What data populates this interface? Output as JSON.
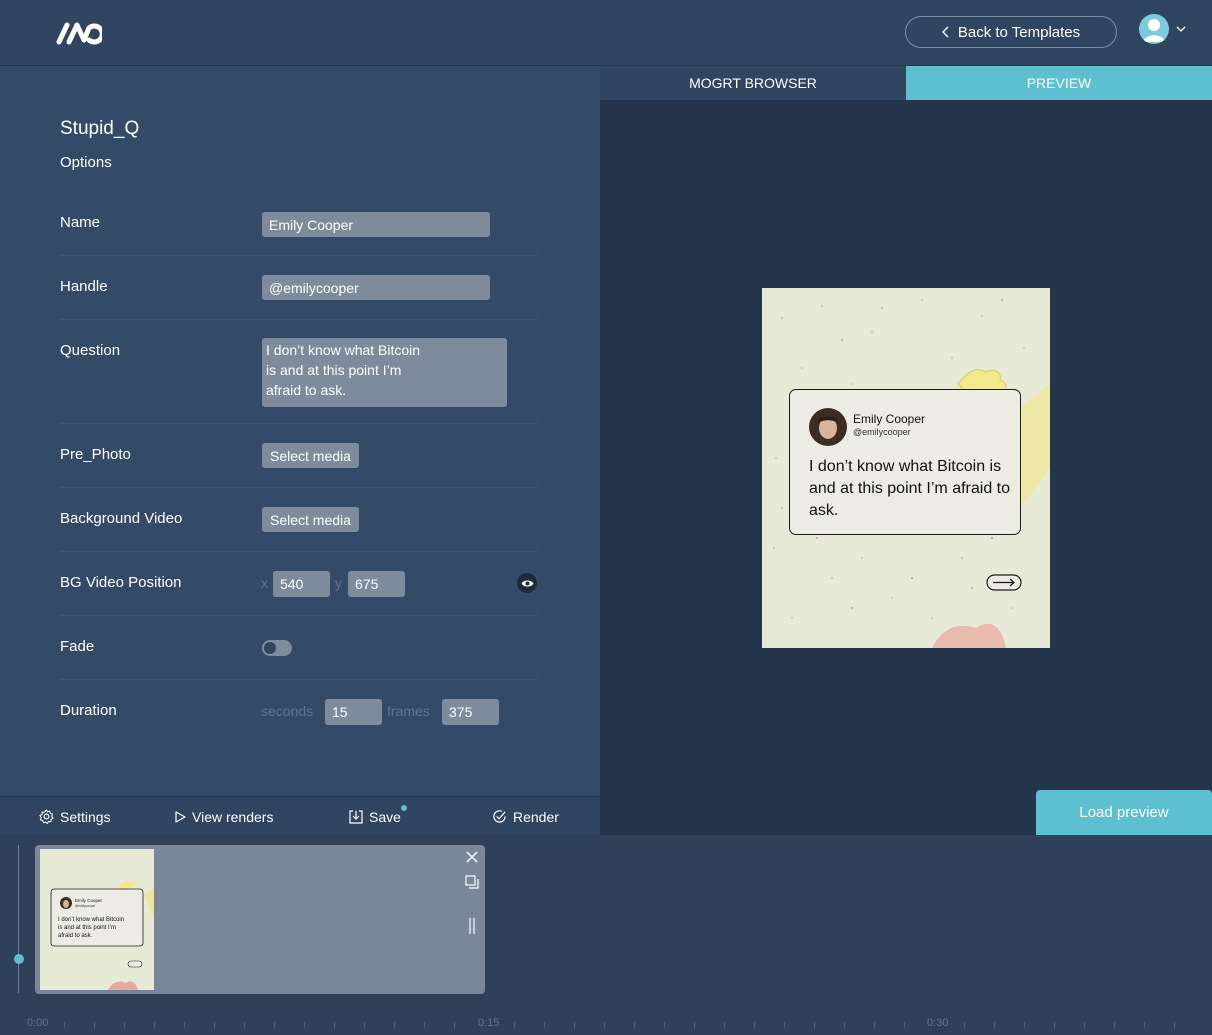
{
  "header": {
    "back_label": "Back to Templates"
  },
  "tabs": [
    {
      "label": "MOGRT BROWSER",
      "active": false
    },
    {
      "label": "PREVIEW",
      "active": true
    }
  ],
  "form": {
    "title": "Stupid_Q",
    "subtitle": "Options",
    "name": {
      "label": "Name",
      "value": "Emily Cooper"
    },
    "handle": {
      "label": "Handle",
      "value": "@emilycooper"
    },
    "question": {
      "label": "Question",
      "value": "I don’t know what Bitcoin\nis and at this point I’m\nafraid to ask."
    },
    "pre_photo": {
      "label": "Pre_Photo",
      "button": "Select media"
    },
    "bg_video": {
      "label": "Background Video",
      "button": "Select media"
    },
    "bg_position": {
      "label": "BG Video Position",
      "x_label": "x",
      "x": "540",
      "y_label": "y",
      "y": "675"
    },
    "fade": {
      "label": "Fade",
      "on": false
    },
    "duration": {
      "label": "Duration",
      "seconds_label": "seconds",
      "seconds": "15",
      "frames_label": "frames",
      "frames": "375"
    }
  },
  "toolbar": {
    "settings": "Settings",
    "view_renders": "View renders",
    "save": "Save",
    "render": "Render"
  },
  "preview": {
    "load_label": "Load preview",
    "tweet_name": "Emily Cooper",
    "tweet_handle": "@emilycooper",
    "tweet_text": "I don’t know what Bitcoin is and at this point I’m afraid to ask."
  },
  "timeline": {
    "labels": [
      "0:00",
      "0:15",
      "0:30"
    ]
  },
  "colors": {
    "accent": "#5dbfcf",
    "panel": "#334b66",
    "preview_bg": "#24354b"
  }
}
